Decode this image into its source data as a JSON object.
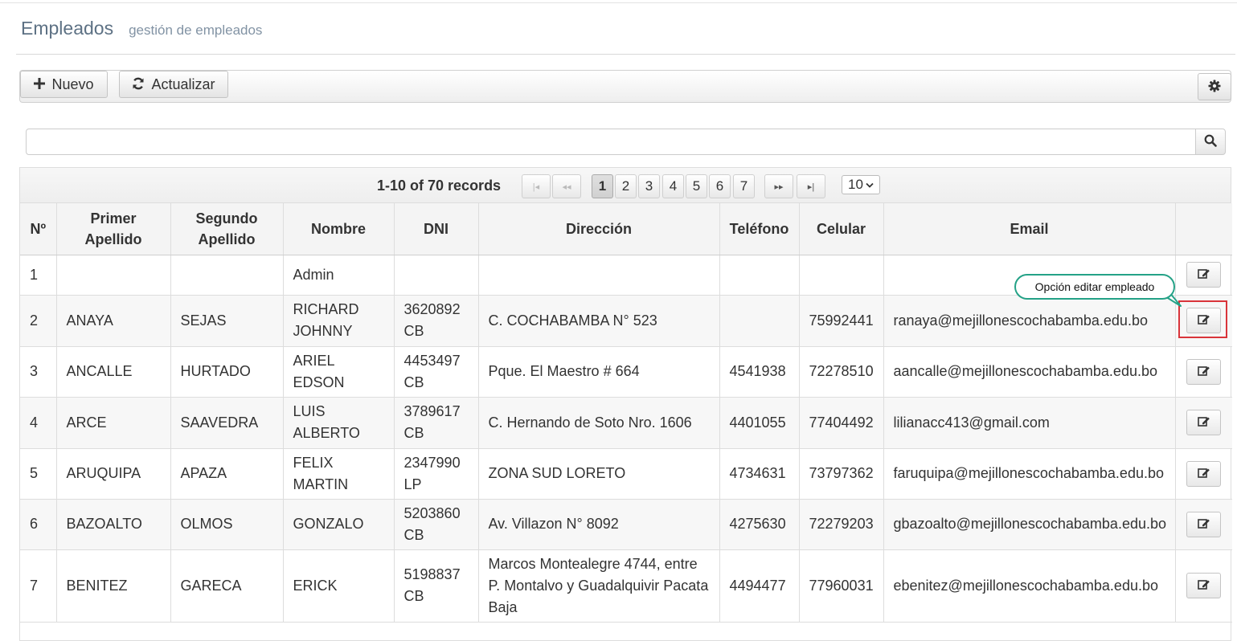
{
  "header": {
    "title": "Empleados",
    "subtitle": "gestión de empleados"
  },
  "toolbar": {
    "new_label": "Nuevo",
    "refresh_label": "Actualizar"
  },
  "search": {
    "value": "",
    "placeholder": ""
  },
  "pager": {
    "records_text": "1-10 of 70 records",
    "pages": [
      "1",
      "2",
      "3",
      "4",
      "5",
      "6",
      "7"
    ],
    "current_page": "1",
    "page_size": "10"
  },
  "table": {
    "columns": [
      "Nº",
      "Primer Apellido",
      "Segundo Apellido",
      "Nombre",
      "DNI",
      "Dirección",
      "Teléfono",
      "Celular",
      "Email",
      ""
    ],
    "rows": [
      [
        "1",
        "",
        "",
        "Admin",
        "",
        "",
        "",
        "",
        ""
      ],
      [
        "2",
        "ANAYA",
        "SEJAS",
        "RICHARD JOHNNY",
        "3620892 CB",
        "C. COCHABAMBA N° 523",
        "",
        "75992441",
        "ranaya@mejillonescochabamba.edu.bo"
      ],
      [
        "3",
        "ANCALLE",
        "HURTADO",
        "ARIEL EDSON",
        "4453497 CB",
        "Pque. El Maestro # 664",
        "4541938",
        "72278510",
        "aancalle@mejillonescochabamba.edu.bo"
      ],
      [
        "4",
        "ARCE",
        "SAAVEDRA",
        "LUIS ALBERTO",
        "3789617 CB",
        "C. Hernando de Soto Nro. 1606",
        "4401055",
        "77404492",
        "lilianacc413@gmail.com"
      ],
      [
        "5",
        "ARUQUIPA",
        "APAZA",
        "FELIX MARTIN",
        "2347990 LP",
        "ZONA SUD LORETO",
        "4734631",
        "73797362",
        "faruquipa@mejillonescochabamba.edu.bo"
      ],
      [
        "6",
        "BAZOALTO",
        "OLMOS",
        "GONZALO",
        "5203860 CB",
        "Av. Villazon N° 8092",
        "4275630",
        "72279203",
        "gbazoalto@mejillonescochabamba.edu.bo"
      ],
      [
        "7",
        "BENITEZ",
        "GARECA",
        "ERICK",
        "5198837 CB",
        "Marcos Montealegre 4744, entre P. Montalvo y Guadalquivir Pacata Baja",
        "4494477",
        "77960031",
        "ebenitez@mejillonescochabamba.edu.bo"
      ]
    ]
  },
  "annotation": {
    "callout_text": "Opción editar empleado"
  },
  "colors": {
    "callout_border": "#25a287",
    "highlight_border": "#d9343a",
    "title": "#5d7184"
  },
  "icons": {
    "new": "plus-icon",
    "refresh": "refresh-icon",
    "settings": "gear-icon",
    "search": "search-icon",
    "edit": "edit-icon",
    "first": "first-page-icon",
    "prev": "prev-page-icon",
    "next": "next-page-icon",
    "last": "last-page-icon"
  }
}
